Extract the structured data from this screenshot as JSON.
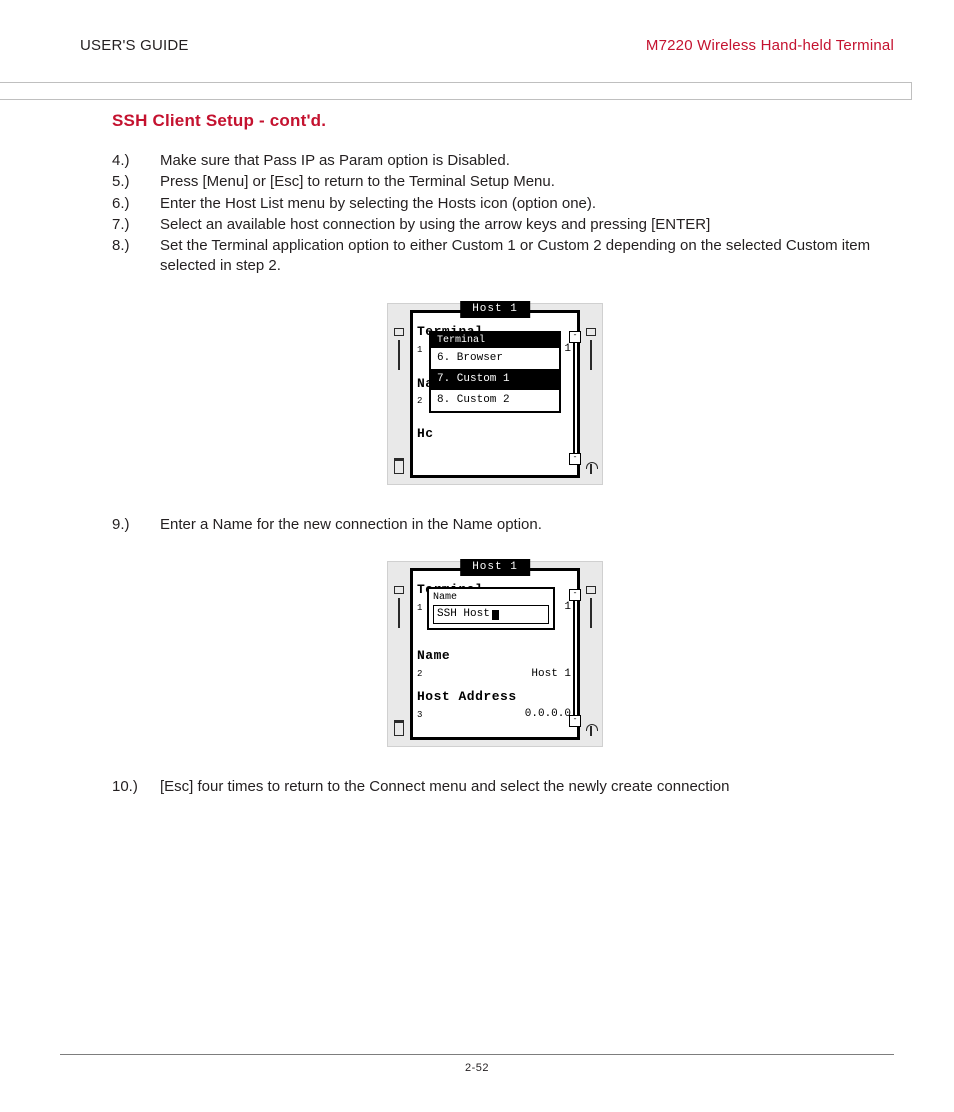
{
  "header": {
    "left": "USER'S GUIDE",
    "right": "M7220 Wireless Hand-held Terminal"
  },
  "section_title": "SSH Client Setup - cont'd.",
  "steps_a": [
    {
      "n": "4.)",
      "t": "Make sure that Pass IP as Param option is Disabled."
    },
    {
      "n": "5.)",
      "t": "Press [Menu] or [Esc] to return to the Terminal Setup Menu."
    },
    {
      "n": "6.)",
      "t": "Enter the Host List menu by selecting the Hosts icon (option one)."
    },
    {
      "n": "7.)",
      "t": "Select an available host connection by using the arrow keys and pressing [ENTER]"
    },
    {
      "n": "8.)",
      "t": "Set the Terminal application option to either Custom 1 or Custom 2 depending on the selected Custom item selected in step 2."
    }
  ],
  "steps_b": [
    {
      "n": "9.)",
      "t": "Enter a Name for the new connection in the Name option."
    }
  ],
  "steps_c": [
    {
      "n": "10.)",
      "t": "[Esc] four times to return to the Connect menu and select the newly create connection"
    }
  ],
  "fig1": {
    "tab": "Host 1",
    "bg1": "Terminal",
    "bg1_idx": "1",
    "bg1_idx_r": "1",
    "bg2": "Na",
    "bg2_idx": "2",
    "bg3": "Hc",
    "popup_title": "Terminal",
    "opts": [
      "6. Browser",
      "7. Custom 1",
      "8. Custom 2"
    ],
    "selected": 1
  },
  "fig2": {
    "tab": "Host 1",
    "row1_title": "Terminal",
    "row1_idx": "1",
    "row1_r": "1",
    "popup_label": "Name",
    "popup_value": "SSH Host",
    "row2_title": "Name",
    "row2_idx": "2",
    "row2_val": "Host 1",
    "row3_title": "Host Address",
    "row3_idx": "3",
    "row3_val": "0.0.0.0"
  },
  "page_number": "2-52"
}
